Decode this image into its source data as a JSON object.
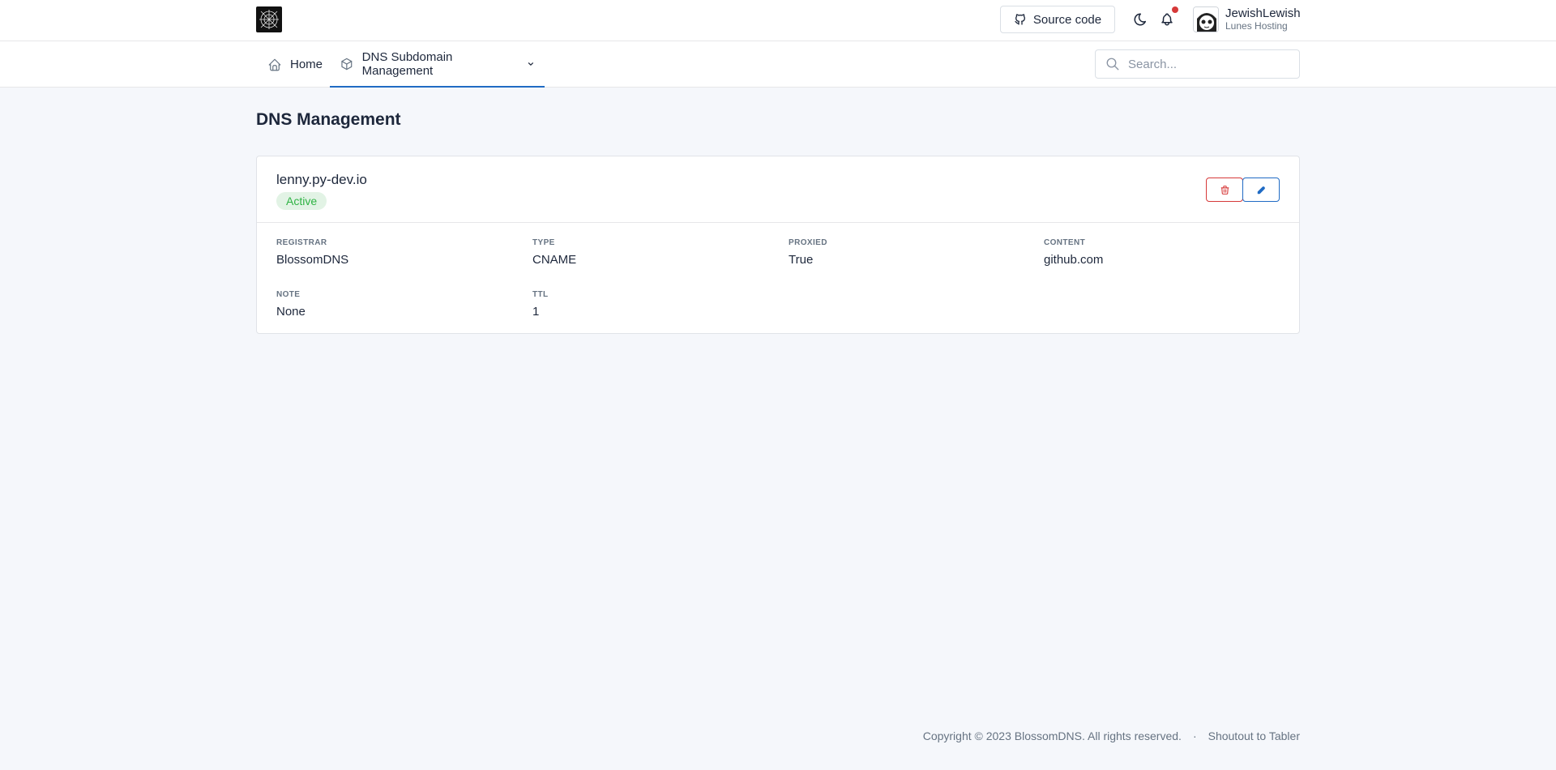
{
  "header": {
    "source_label": "Source code",
    "user": {
      "name": "JewishLewish",
      "subtitle": "Lunes Hosting"
    }
  },
  "nav": {
    "home_label": "Home",
    "dns_label": "DNS Subdomain Management"
  },
  "search": {
    "placeholder": "Search..."
  },
  "page": {
    "title": "DNS Management"
  },
  "record": {
    "domain": "lenny.py-dev.io",
    "status": "Active",
    "fields": [
      {
        "label": "REGISTRAR",
        "value": "BlossomDNS"
      },
      {
        "label": "TYPE",
        "value": "CNAME"
      },
      {
        "label": "PROXIED",
        "value": "True"
      },
      {
        "label": "CONTENT",
        "value": "github.com"
      },
      {
        "label": "NOTE",
        "value": "None"
      },
      {
        "label": "TTL",
        "value": "1"
      }
    ]
  },
  "footer": {
    "copyright": "Copyright © 2023 BlossomDNS. All rights reserved.",
    "separator": "·",
    "link": "Shoutout to Tabler"
  },
  "colors": {
    "accent": "#206bc4",
    "danger": "#d63939",
    "success": "#2fb344",
    "background": "#f5f7fb"
  }
}
